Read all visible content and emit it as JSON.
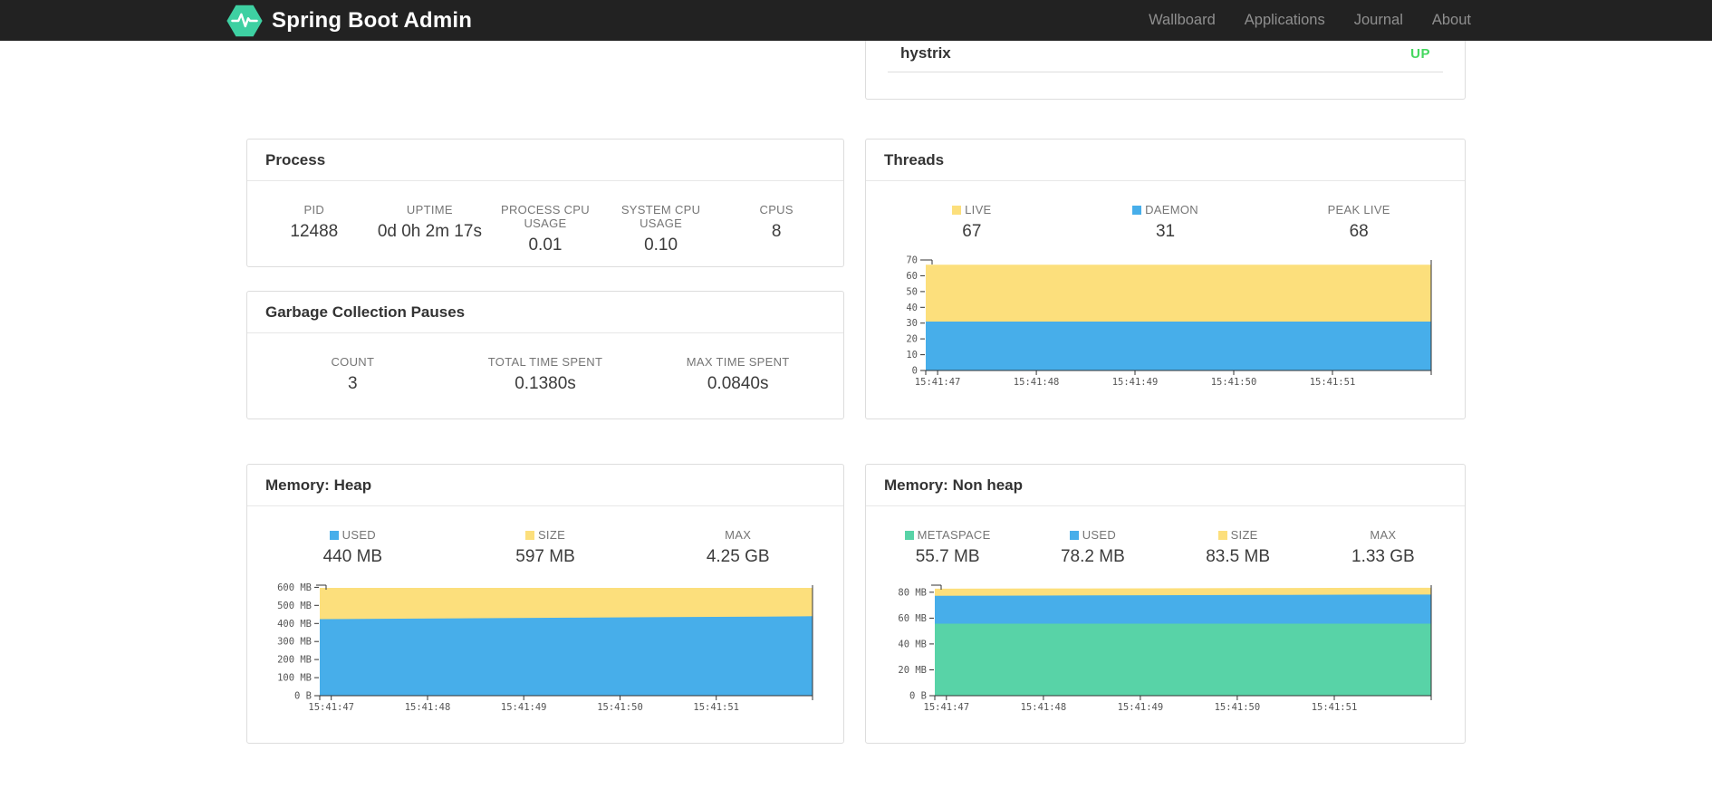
{
  "navbar": {
    "brand": "Spring Boot Admin",
    "links": [
      "Wallboard",
      "Applications",
      "Journal",
      "About"
    ]
  },
  "health": {
    "service": "hystrix",
    "status": "UP",
    "status_color": "#45d75f"
  },
  "colors": {
    "navbar_bg": "#222222",
    "logo_green": "#3ed0a2",
    "series_yellow": "#fcdf7c",
    "series_blue": "#47aeea",
    "series_green": "#58d3a7"
  },
  "cards": {
    "process": {
      "title": "Process",
      "metrics": [
        {
          "label": "PID",
          "value": "12488"
        },
        {
          "label": "UPTIME",
          "value": "0d 0h 2m 17s"
        },
        {
          "label": "PROCESS CPU USAGE",
          "value": "0.01"
        },
        {
          "label": "SYSTEM CPU USAGE",
          "value": "0.10"
        },
        {
          "label": "CPUS",
          "value": "8"
        }
      ]
    },
    "gc": {
      "title": "Garbage Collection Pauses",
      "metrics": [
        {
          "label": "COUNT",
          "value": "3"
        },
        {
          "label": "TOTAL TIME SPENT",
          "value": "0.1380s"
        },
        {
          "label": "MAX TIME SPENT",
          "value": "0.0840s"
        }
      ]
    },
    "threads": {
      "title": "Threads",
      "metrics": [
        {
          "label": "LIVE",
          "value": "67",
          "swatch": "#fcdf7c"
        },
        {
          "label": "DAEMON",
          "value": "31",
          "swatch": "#47aeea"
        },
        {
          "label": "PEAK LIVE",
          "value": "68"
        }
      ]
    },
    "heap": {
      "title": "Memory: Heap",
      "metrics": [
        {
          "label": "USED",
          "value": "440 MB",
          "swatch": "#47aeea"
        },
        {
          "label": "SIZE",
          "value": "597 MB",
          "swatch": "#fcdf7c"
        },
        {
          "label": "MAX",
          "value": "4.25 GB"
        }
      ]
    },
    "nonheap": {
      "title": "Memory: Non heap",
      "metrics": [
        {
          "label": "METASPACE",
          "value": "55.7 MB",
          "swatch": "#58d3a7"
        },
        {
          "label": "USED",
          "value": "78.2 MB",
          "swatch": "#47aeea"
        },
        {
          "label": "SIZE",
          "value": "83.5 MB",
          "swatch": "#fcdf7c"
        },
        {
          "label": "MAX",
          "value": "1.33 GB"
        }
      ]
    }
  },
  "chart_data": [
    {
      "name": "threads",
      "type": "area",
      "x_tick_labels": [
        "15:41:47",
        "15:41:48",
        "15:41:49",
        "15:41:50",
        "15:41:51"
      ],
      "x_tick_values": [
        47,
        48,
        49,
        50,
        51
      ],
      "x_range": [
        46.88,
        52.0
      ],
      "x": [
        46.88,
        47.5,
        48.5,
        49.5,
        50.5,
        51.5,
        52.0
      ],
      "ylim": [
        0,
        70
      ],
      "y_ticks": [
        {
          "v": 0,
          "label": "0"
        },
        {
          "v": 10,
          "label": "10"
        },
        {
          "v": 20,
          "label": "20"
        },
        {
          "v": 30,
          "label": "30"
        },
        {
          "v": 40,
          "label": "40"
        },
        {
          "v": 50,
          "label": "50"
        },
        {
          "v": 60,
          "label": "60"
        },
        {
          "v": 70,
          "label": "70"
        }
      ],
      "series": [
        {
          "name": "live",
          "color": "#fcdf7c",
          "values": [
            67,
            67,
            67,
            67,
            67,
            67,
            67
          ]
        },
        {
          "name": "daemon",
          "color": "#47aeea",
          "values": [
            31,
            31,
            31,
            31,
            31,
            31,
            31
          ]
        }
      ]
    },
    {
      "name": "heap",
      "type": "area",
      "x_tick_labels": [
        "15:41:47",
        "15:41:48",
        "15:41:49",
        "15:41:50",
        "15:41:51"
      ],
      "x_tick_values": [
        47,
        48,
        49,
        50,
        51
      ],
      "x_range": [
        46.88,
        52.0
      ],
      "x": [
        46.88,
        47.5,
        48.5,
        49.5,
        50.5,
        51.5,
        52.0
      ],
      "ylim": [
        0,
        612
      ],
      "y_ticks": [
        {
          "v": 0,
          "label": "0 B"
        },
        {
          "v": 100,
          "label": "100 MB"
        },
        {
          "v": 200,
          "label": "200 MB"
        },
        {
          "v": 300,
          "label": "300 MB"
        },
        {
          "v": 400,
          "label": "400 MB"
        },
        {
          "v": 500,
          "label": "500 MB"
        },
        {
          "v": 600,
          "label": "600 MB"
        }
      ],
      "series": [
        {
          "name": "size",
          "color": "#fcdf7c",
          "values": [
            597,
            597,
            597,
            597,
            597,
            597,
            597
          ]
        },
        {
          "name": "used",
          "color": "#47aeea",
          "values": [
            424,
            426,
            429,
            432,
            435,
            438,
            440
          ]
        }
      ]
    },
    {
      "name": "nonheap",
      "type": "area",
      "x_tick_labels": [
        "15:41:47",
        "15:41:48",
        "15:41:49",
        "15:41:50",
        "15:41:51"
      ],
      "x_tick_values": [
        47,
        48,
        49,
        50,
        51
      ],
      "x_range": [
        46.88,
        52.0
      ],
      "x": [
        46.88,
        47.5,
        48.5,
        49.5,
        50.5,
        51.5,
        52.0
      ],
      "ylim": [
        0,
        85.5
      ],
      "y_ticks": [
        {
          "v": 0,
          "label": "0 B"
        },
        {
          "v": 20,
          "label": "20 MB"
        },
        {
          "v": 40,
          "label": "40 MB"
        },
        {
          "v": 60,
          "label": "60 MB"
        },
        {
          "v": 80,
          "label": "80 MB"
        }
      ],
      "series": [
        {
          "name": "size",
          "color": "#fcdf7c",
          "values": [
            82.8,
            82.9,
            83.0,
            83.1,
            83.3,
            83.5,
            83.5
          ]
        },
        {
          "name": "used",
          "color": "#47aeea",
          "values": [
            77.2,
            77.4,
            77.6,
            77.8,
            78.0,
            78.2,
            78.2
          ]
        },
        {
          "name": "metaspace",
          "color": "#58d3a7",
          "values": [
            55.7,
            55.7,
            55.7,
            55.7,
            55.7,
            55.7,
            55.7
          ]
        }
      ]
    }
  ]
}
